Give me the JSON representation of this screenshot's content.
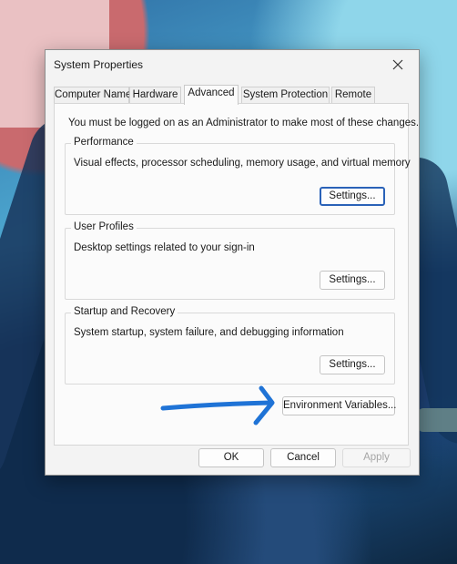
{
  "dialog": {
    "title": "System Properties",
    "close_icon": "close-icon"
  },
  "tabs": [
    {
      "label": "Computer Name",
      "active": false
    },
    {
      "label": "Hardware",
      "active": false
    },
    {
      "label": "Advanced",
      "active": true
    },
    {
      "label": "System Protection",
      "active": false
    },
    {
      "label": "Remote",
      "active": false
    }
  ],
  "advanced": {
    "notice": "You must be logged on as an Administrator to make most of these changes.",
    "groups": [
      {
        "title": "Performance",
        "description": "Visual effects, processor scheduling, memory usage, and virtual memory",
        "button": "Settings..."
      },
      {
        "title": "User Profiles",
        "description": "Desktop settings related to your sign-in",
        "button": "Settings..."
      },
      {
        "title": "Startup and Recovery",
        "description": "System startup, system failure, and debugging information",
        "button": "Settings..."
      }
    ],
    "env_button": "Environment Variables..."
  },
  "footer": {
    "ok": "OK",
    "cancel": "Cancel",
    "apply": "Apply"
  },
  "annotation": {
    "arrow_color": "#1f73d6"
  }
}
